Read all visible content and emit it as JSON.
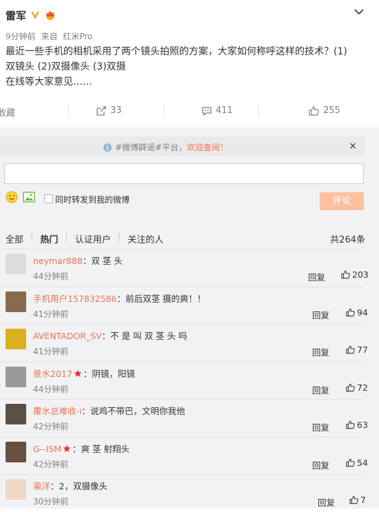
{
  "post": {
    "username": "雷军",
    "time": "9分钟前",
    "from_label": "来自",
    "source": "红米Pro",
    "text_line1": "最近一些手机的相机采用了两个镜头拍照的方案，大家如何称呼这样的技术？(1)",
    "text_line2": "双镜头 (2)双摄像头 (3)双摄",
    "text_line3": "在线等大家意见……"
  },
  "actions": {
    "favorite": "收藏",
    "forward_count": "33",
    "comment_count": "411",
    "like_count": "255"
  },
  "notice": {
    "prefix": "#微博辟谣#平台，",
    "highlight": "欢迎查阅！",
    "close": "×"
  },
  "composer": {
    "forward_label": "同时转发到我的微博",
    "submit": "评论"
  },
  "filter": {
    "tabs": [
      "全部",
      "热门",
      "认证用户",
      "关注的人"
    ],
    "total": "共264条"
  },
  "comments": [
    {
      "name": "neymar888",
      "text": "：双 茎 头",
      "time": "44分钟前",
      "reply": "回复",
      "likes": "203",
      "star": false,
      "avatar_color": "#dcdcdc"
    },
    {
      "name": "手机用户157832586",
      "text": "：前后双茎  摄的爽！！",
      "time": "41分钟前",
      "reply": "回复",
      "likes": "94",
      "star": false,
      "avatar_color": "#8a6a4c"
    },
    {
      "name": "AVENTADOR_SV",
      "text": "：不 是 叫 双 茎 头 吗",
      "time": "41分钟前",
      "reply": "回复",
      "likes": "77",
      "star": false,
      "avatar_color": "#d8b020"
    },
    {
      "name": "景水2017",
      "text": "：阴镜，阳镜",
      "time": "44分钟前",
      "reply": "回复",
      "likes": "72",
      "star": true,
      "avatar_color": "#9a9a9a"
    },
    {
      "name": "覆水总难收-i",
      "text": "：说鸡不带巴，文明你我他",
      "time": "42分钟前",
      "reply": "回复",
      "likes": "63",
      "star": false,
      "avatar_color": "#5a5048"
    },
    {
      "name": "G--ISM",
      "text": "：爽 茎 射翔头",
      "time": "42分钟前",
      "reply": "回复",
      "likes": "54",
      "star": true,
      "avatar_color": "#6a5040"
    },
    {
      "name": "渠洋",
      "text": "：2，双摄像头",
      "time": "30分钟前",
      "reply": "回复",
      "likes": "7",
      "star": false,
      "avatar_color": "#f0d8c8"
    }
  ],
  "colors": {
    "accent": "#eb7350",
    "muted": "#808080",
    "button": "#ffc09f"
  }
}
